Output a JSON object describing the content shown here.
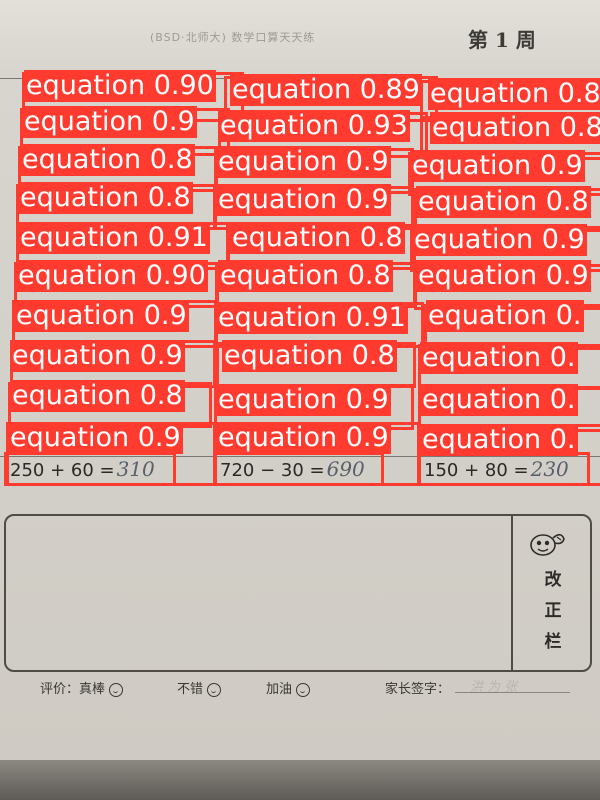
{
  "header": {
    "subtitle": "(BSD·北师大) 数学口算天天练",
    "week": "第 1 周"
  },
  "detection": {
    "label": "equation"
  },
  "detections": [
    {
      "score": "0.90"
    },
    {
      "score": "0.89"
    },
    {
      "score": "0.8"
    },
    {
      "score": "0.9"
    },
    {
      "score": "0.93"
    },
    {
      "score": "0.8"
    },
    {
      "score": "0.8"
    },
    {
      "score": "0.9"
    },
    {
      "score": "0.9"
    },
    {
      "score": "0.8"
    },
    {
      "score": "0.9"
    },
    {
      "score": "0.8"
    },
    {
      "score": "0.91"
    },
    {
      "score": "0.8"
    },
    {
      "score": "0.9"
    },
    {
      "score": "0.90"
    },
    {
      "score": "0.8"
    },
    {
      "score": "0.9"
    },
    {
      "score": "0.9"
    },
    {
      "score": "0.91"
    },
    {
      "score": "0."
    },
    {
      "score": "0.9"
    },
    {
      "score": "0.8"
    },
    {
      "score": "0."
    },
    {
      "score": "0.8"
    },
    {
      "score": "0.9"
    },
    {
      "score": "0."
    },
    {
      "score": "0.9"
    },
    {
      "score": "0.9"
    },
    {
      "score": "0."
    },
    {
      "score": ""
    },
    {
      "score": ""
    },
    {
      "score": ""
    }
  ],
  "equations": [
    {
      "text": "250 + 60 =",
      "answer": "310"
    },
    {
      "text": "720 − 30 =",
      "answer": "690"
    },
    {
      "text": "150 + 80 =",
      "answer": "230"
    }
  ],
  "correction": {
    "label_chars": [
      "改",
      "正",
      "栏"
    ]
  },
  "rating": {
    "prefix": "评价：真棒",
    "ok": "不错",
    "try": "加油",
    "parent_sig": "家长签字：",
    "signature_ghost": "洪 为 张"
  }
}
